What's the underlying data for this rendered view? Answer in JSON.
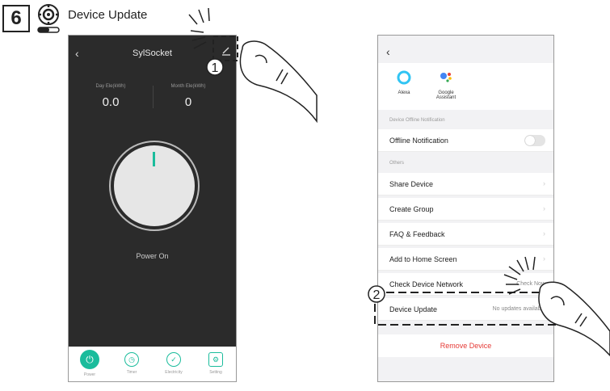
{
  "step": {
    "number": "6",
    "title": "Device Update"
  },
  "phone1": {
    "title": "SylSocket",
    "day_label": "Day Ele(kWh)",
    "day_value": "0.0",
    "month_label": "Month Ele(kWh)",
    "month_value": "0",
    "status": "Power On",
    "tabs": [
      {
        "label": "Power",
        "icon": "power-icon"
      },
      {
        "label": "Timer",
        "icon": "clock-icon"
      },
      {
        "label": "Electricity",
        "icon": "electricity-icon"
      },
      {
        "label": "Setting",
        "icon": "gear-icon"
      }
    ]
  },
  "phone2": {
    "assistants": [
      {
        "label": "Alexa"
      },
      {
        "label": "Google Assistant"
      }
    ],
    "section_offline": "Device Offline Notification",
    "offline_label": "Offline Notification",
    "section_others": "Others",
    "rows": {
      "share": "Share Device",
      "group": "Create Group",
      "faq": "FAQ & Feedback",
      "home": "Add to Home Screen",
      "network": "Check Device Network",
      "network_value": "Check Now",
      "update": "Device Update",
      "update_value": "No updates available"
    },
    "remove": "Remove Device"
  },
  "markers": {
    "one": "1",
    "two": "2"
  },
  "colors": {
    "accent": "#1abc9c",
    "danger": "#e53935"
  }
}
